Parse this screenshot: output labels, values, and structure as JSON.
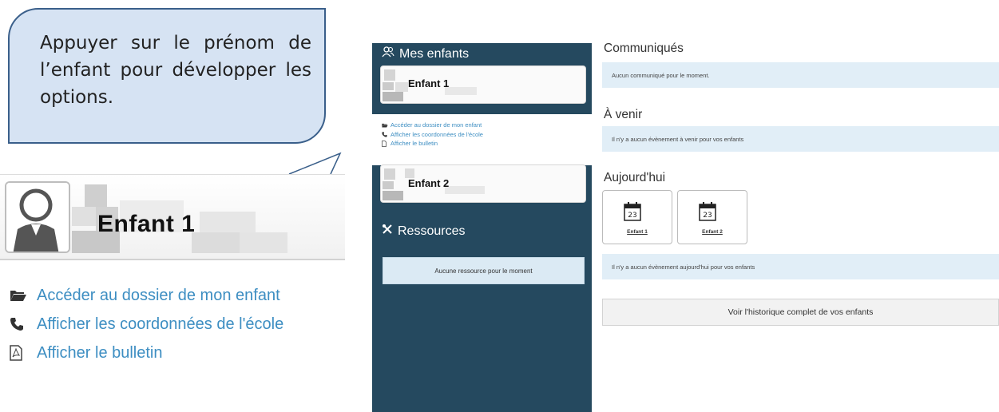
{
  "callout": {
    "text": "Appuyer sur le prénom de l’enfant pour développer les options."
  },
  "zoom": {
    "child_name": "Enfant 1",
    "links": [
      {
        "icon": "folder-open-icon",
        "label": "Accéder au dossier de mon enfant"
      },
      {
        "icon": "phone-icon",
        "label": "Afficher les coordonnées de l'école"
      },
      {
        "icon": "pdf-file-icon",
        "label": "Afficher le bulletin"
      }
    ]
  },
  "app": {
    "sidebar": {
      "children_heading": "Mes enfants",
      "children": [
        {
          "name": "Enfant 1"
        },
        {
          "name": "Enfant 2"
        }
      ],
      "child_menu": [
        {
          "icon": "folder-open-icon",
          "label": "Accéder au dossier de mon enfant"
        },
        {
          "icon": "phone-icon",
          "label": "Afficher les coordonnées de l'école"
        },
        {
          "icon": "pdf-file-icon",
          "label": "Afficher le bulletin"
        }
      ],
      "resources_heading": "Ressources",
      "resources_empty": "Aucune ressource pour le moment"
    },
    "main": {
      "communiques": {
        "title": "Communiqués",
        "empty": "Aucun communiqué pour le moment."
      },
      "a_venir": {
        "title": "À venir",
        "empty": "Il n'y a aucun évènement à venir pour vos enfants"
      },
      "aujourdhui": {
        "title": "Aujourd'hui",
        "tiles": [
          {
            "day": "23",
            "label": "Enfant 1"
          },
          {
            "day": "23",
            "label": "Enfant 2"
          }
        ],
        "empty": "Il n'y a aucun évènement aujourd'hui pour vos enfants"
      },
      "history_button": "Voir l'historique complet de vos enfants"
    },
    "colors": {
      "sidebar": "#25495f",
      "link": "#3d8ec2",
      "info_bar": "#e1eef7",
      "callout_fill": "#d6e3f3",
      "callout_border": "#3a5f8a"
    }
  }
}
